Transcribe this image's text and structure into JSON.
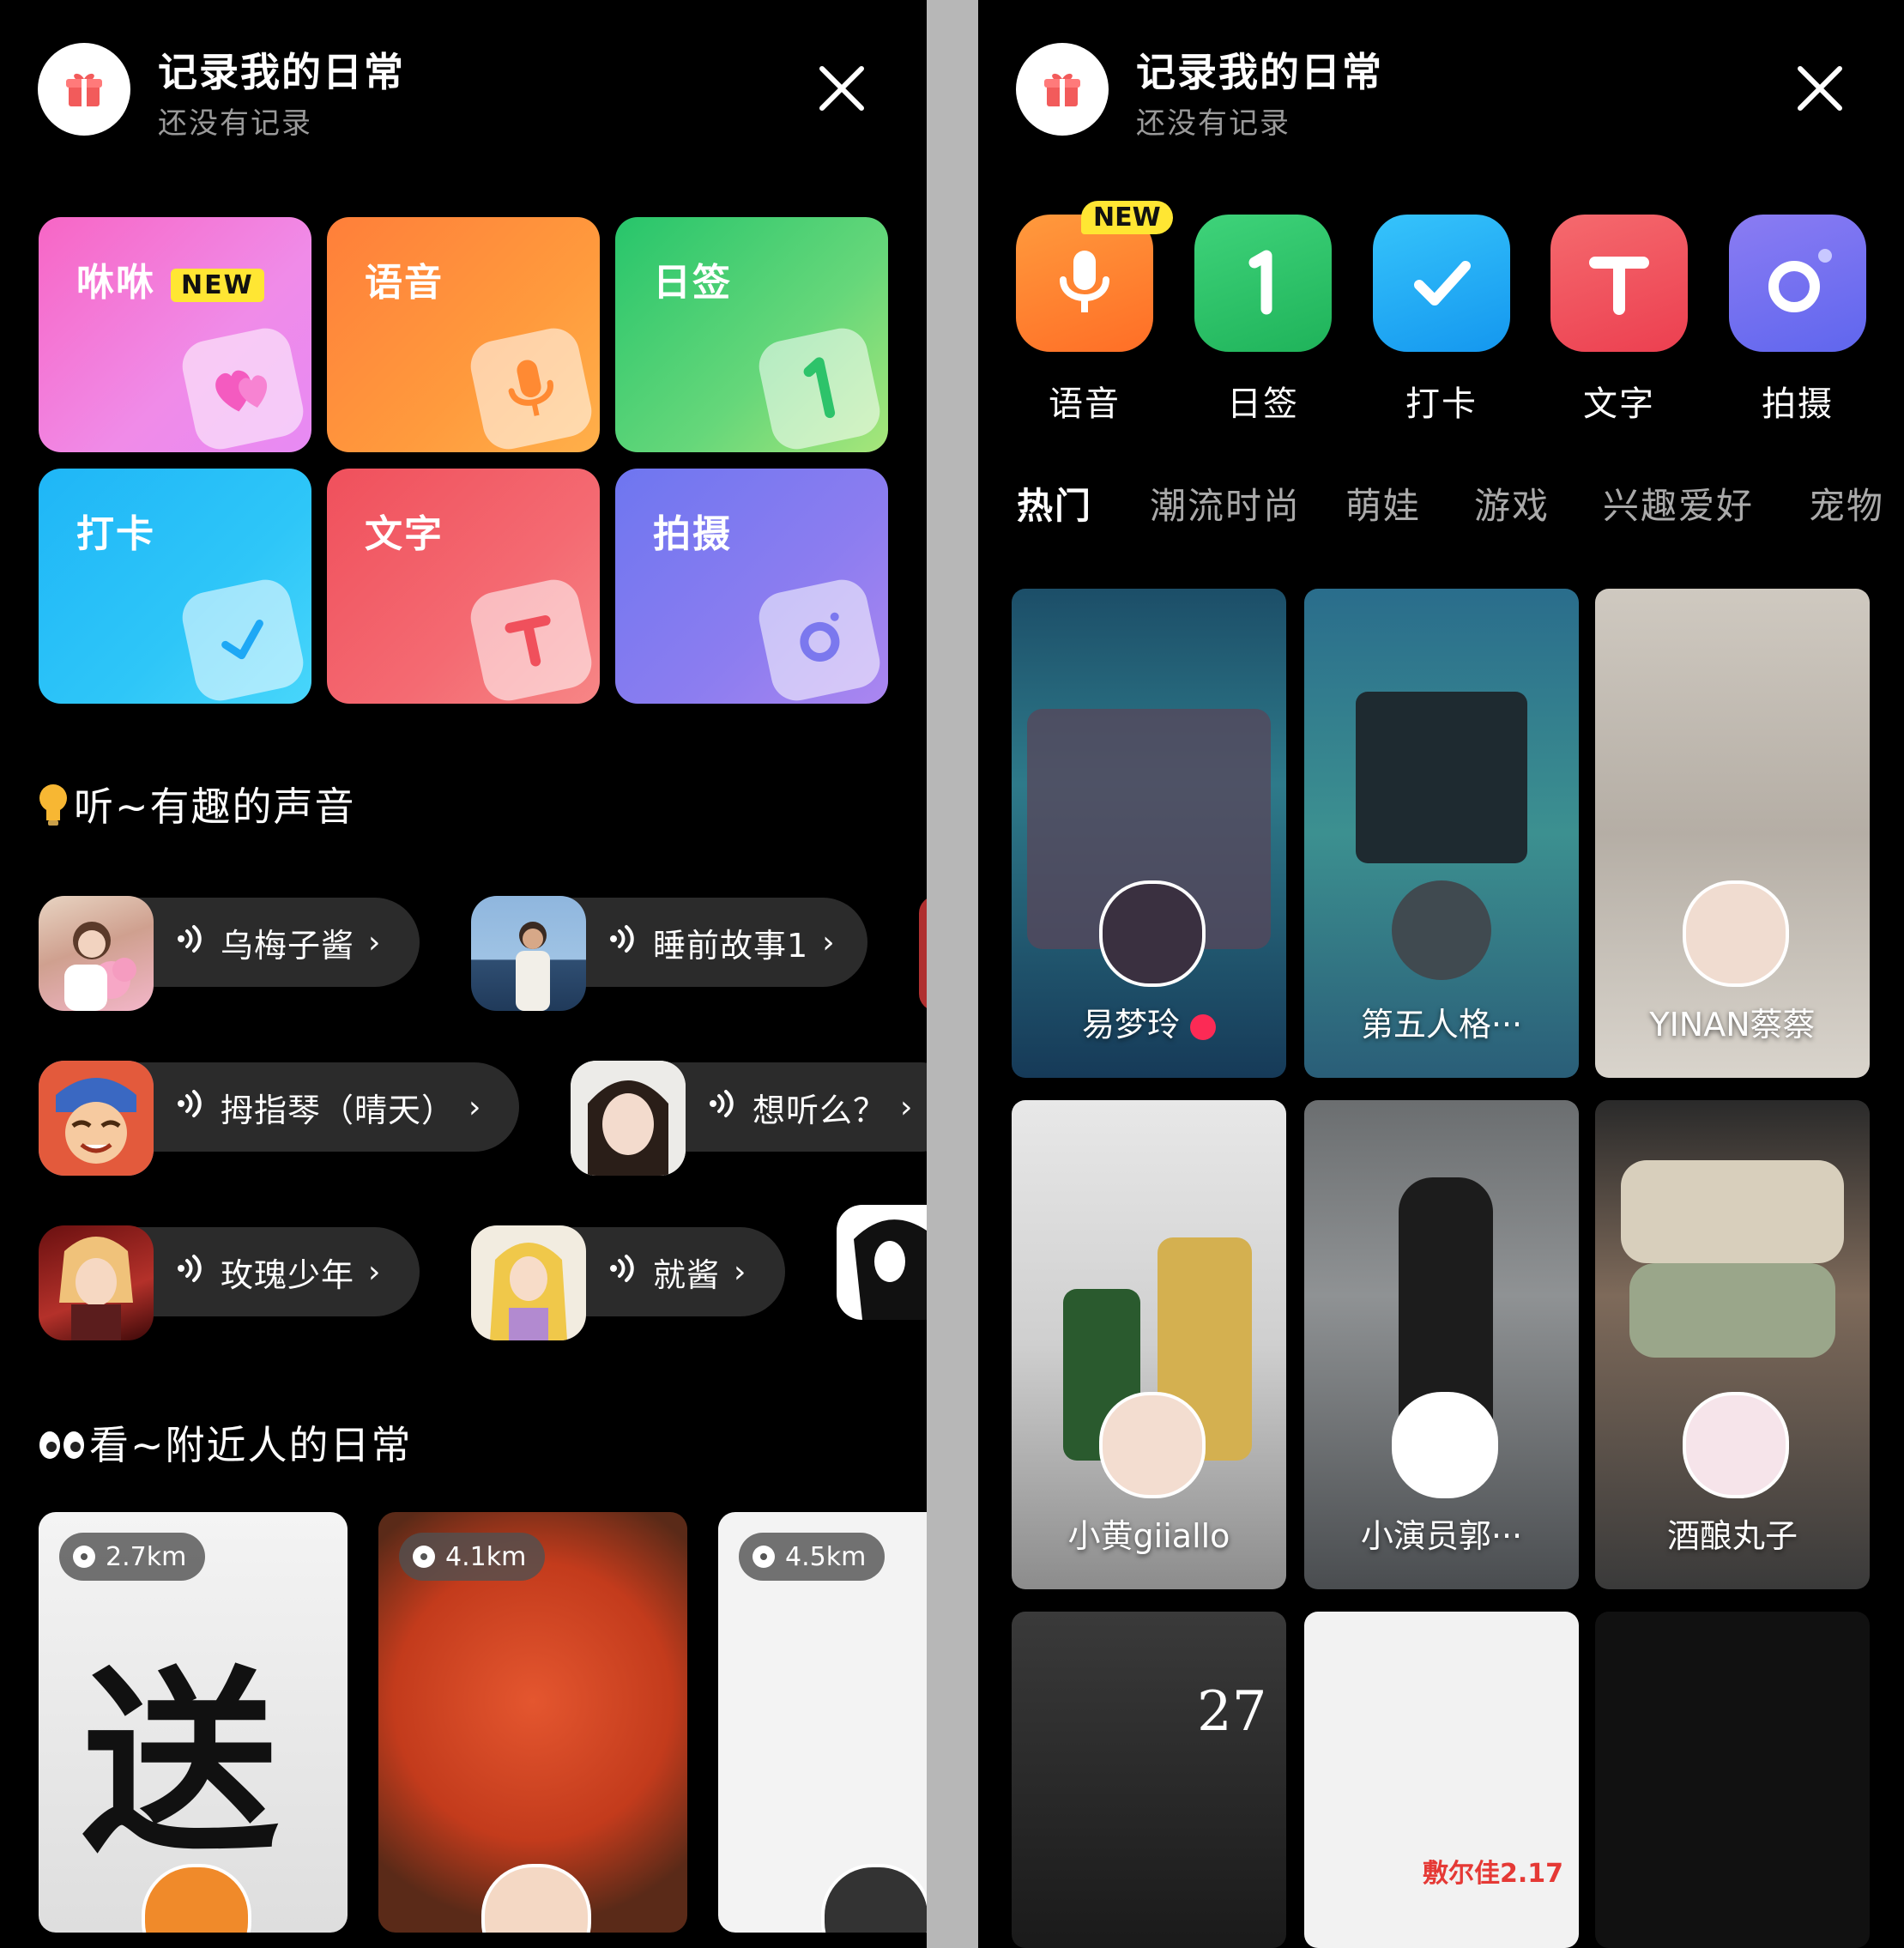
{
  "left": {
    "header": {
      "title": "记录我的日常",
      "subtitle": "还没有记录"
    },
    "tiles": [
      {
        "label": "咻咻",
        "badge": "NEW"
      },
      {
        "label": "语音"
      },
      {
        "label": "日签"
      },
      {
        "label": "打卡"
      },
      {
        "label": "文字"
      },
      {
        "label": "拍摄"
      }
    ],
    "listen_section": {
      "title": "听~有趣的声音"
    },
    "sounds": [
      {
        "label": "乌梅子酱"
      },
      {
        "label": "睡前故事1"
      },
      {
        "label": "拇指琴（晴天）"
      },
      {
        "label": "想听么？"
      },
      {
        "label": "玫瑰少年"
      },
      {
        "label": "就酱"
      }
    ],
    "chevron": "›",
    "nearby_section": {
      "title": "看~附近人的日常"
    },
    "nearby": [
      {
        "distance": "2.7km",
        "big_text": "送"
      },
      {
        "distance": "4.1km"
      },
      {
        "distance": "4.5km"
      }
    ]
  },
  "right": {
    "header": {
      "title": "记录我的日常",
      "subtitle": "还没有记录"
    },
    "apps": [
      {
        "label": "语音",
        "badge": "NEW",
        "color": "#ff7a2b"
      },
      {
        "label": "日签",
        "color": "#22c46a"
      },
      {
        "label": "打卡",
        "color": "#1ea8f5"
      },
      {
        "label": "文字",
        "color": "#f0505c"
      },
      {
        "label": "拍摄",
        "color": "#6b6cf2"
      }
    ],
    "tabs": [
      "热门",
      "潮流时尚",
      "萌娃",
      "游戏",
      "兴趣爱好",
      "宠物"
    ],
    "cards": [
      {
        "name": "易梦玲"
      },
      {
        "name": "第五人格···"
      },
      {
        "name": "YINAN蔡蔡"
      },
      {
        "name": "小黄giiallo"
      },
      {
        "name": "小演员郭···"
      },
      {
        "name": "酒酿丸子"
      },
      {
        "text": "27"
      },
      {
        "text": "敷尔佳2.17"
      },
      {}
    ]
  }
}
